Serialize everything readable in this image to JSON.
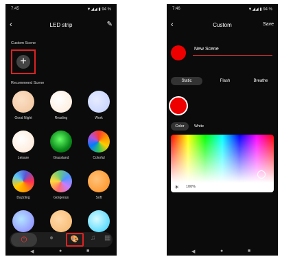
{
  "left": {
    "status": {
      "time": "7:45",
      "right": "▼◢◢ ▮ 94 %"
    },
    "header": {
      "back": "‹",
      "title": "LED strip",
      "edit": "✎"
    },
    "custom_label": "Custom Scene",
    "add_symbol": "+",
    "recommend_label": "Recommend Scene",
    "scenes": [
      {
        "name": "Good Night",
        "color": "#f3c9a2"
      },
      {
        "name": "Reading",
        "color": "#fff1e4"
      },
      {
        "name": "Work",
        "color": "#cdd8ff"
      },
      {
        "name": "Leisure",
        "color": "#fff0e2"
      },
      {
        "name": "Grassland",
        "color": "#2ecc40"
      },
      {
        "name": "Colorful",
        "color": "#f58220"
      },
      {
        "name": "Dazzling",
        "color": "#f15a24"
      },
      {
        "name": "Gorgeous",
        "color": "#8e44ad"
      },
      {
        "name": "Soft",
        "color": "#ffa34d"
      },
      {
        "name": "",
        "color": "#8ab6ff"
      },
      {
        "name": "",
        "color": "#f5c48a"
      },
      {
        "name": "",
        "color": "#5ce0ff"
      }
    ],
    "bottom": {
      "power": "⏻",
      "bulb": "●",
      "palette": "🎨",
      "music": "♫",
      "grid": "▦"
    },
    "nav": {
      "back": "◀",
      "home": "●",
      "recents": "■"
    }
  },
  "right": {
    "status": {
      "time": "7:46",
      "right": "▼◢◢ ▮ 94 %"
    },
    "header": {
      "back": "‹",
      "title": "Custom",
      "save": "Save"
    },
    "scene_name": "New Scene",
    "modes": [
      "Static",
      "Flash",
      "Breathe"
    ],
    "tabs": [
      "Color",
      "White"
    ],
    "brightness": "100%",
    "sun": "☀",
    "nav": {
      "back": "◀",
      "home": "●",
      "recents": "■"
    }
  }
}
